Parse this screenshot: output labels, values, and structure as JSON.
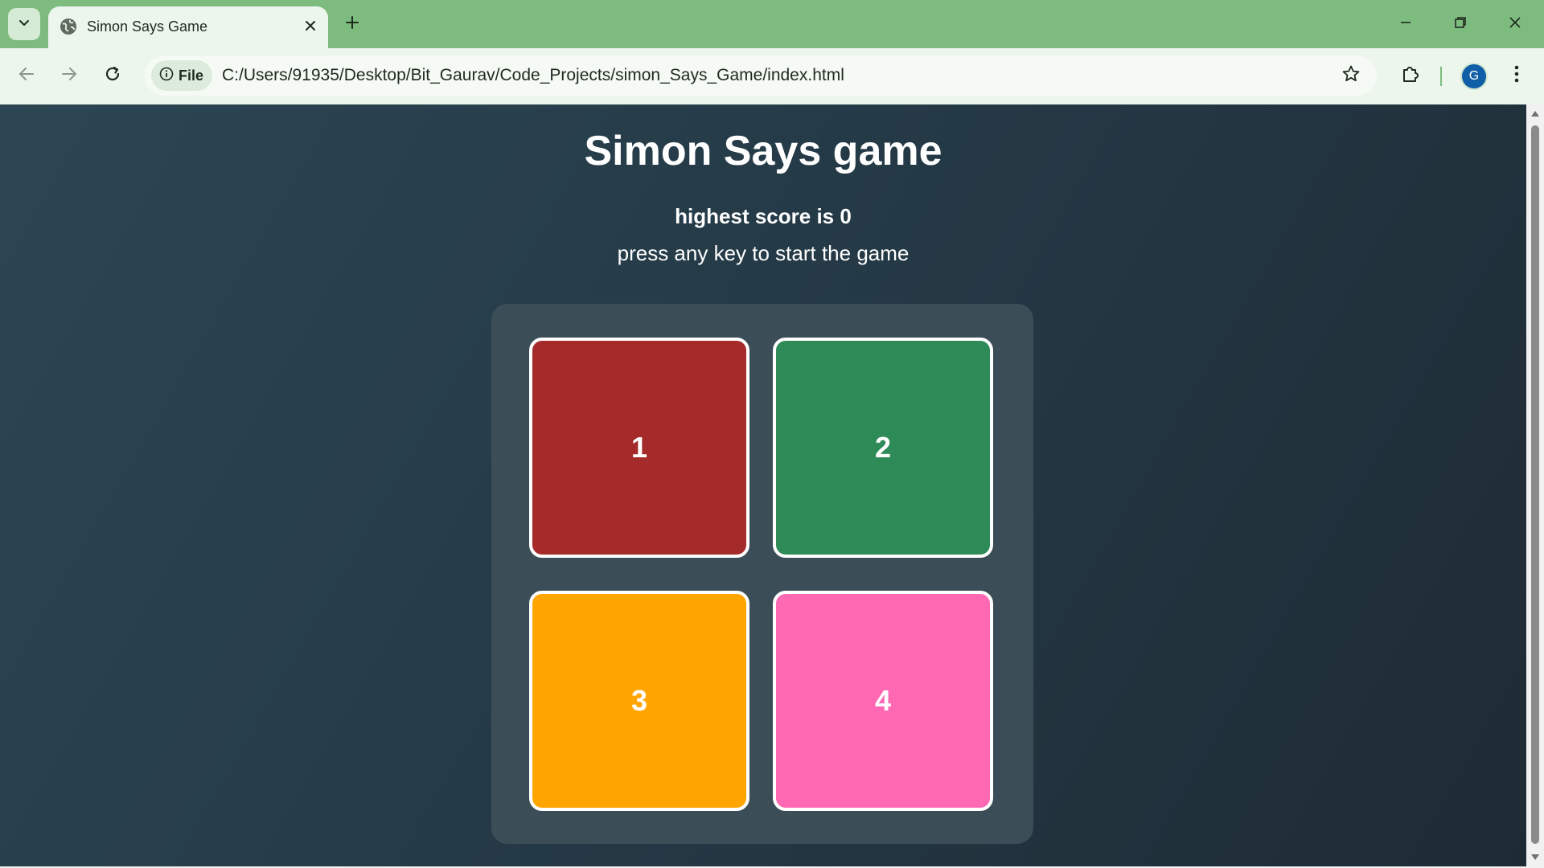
{
  "browser": {
    "tab": {
      "title": "Simon Says Game",
      "favicon": "globe-icon"
    },
    "address_bar": {
      "site_info_label": "File",
      "url": "C:/Users/91935/Desktop/Bit_Gaurav/Code_Projects/simon_Says_Game/index.html"
    },
    "profile_initial": "G",
    "colors": {
      "frame": "#7dbc7e",
      "toolbar": "#edf6ec",
      "avatar": "#0f5ea8"
    }
  },
  "page": {
    "title": "Simon Says game",
    "score_text": "highest score is 0",
    "prompt_text": "press any key to start the game",
    "pads": [
      {
        "label": "1",
        "color": "#a52a2a"
      },
      {
        "label": "2",
        "color": "#2e8b57"
      },
      {
        "label": "3",
        "color": "#ffa500"
      },
      {
        "label": "4",
        "color": "#ff69b4"
      }
    ]
  }
}
